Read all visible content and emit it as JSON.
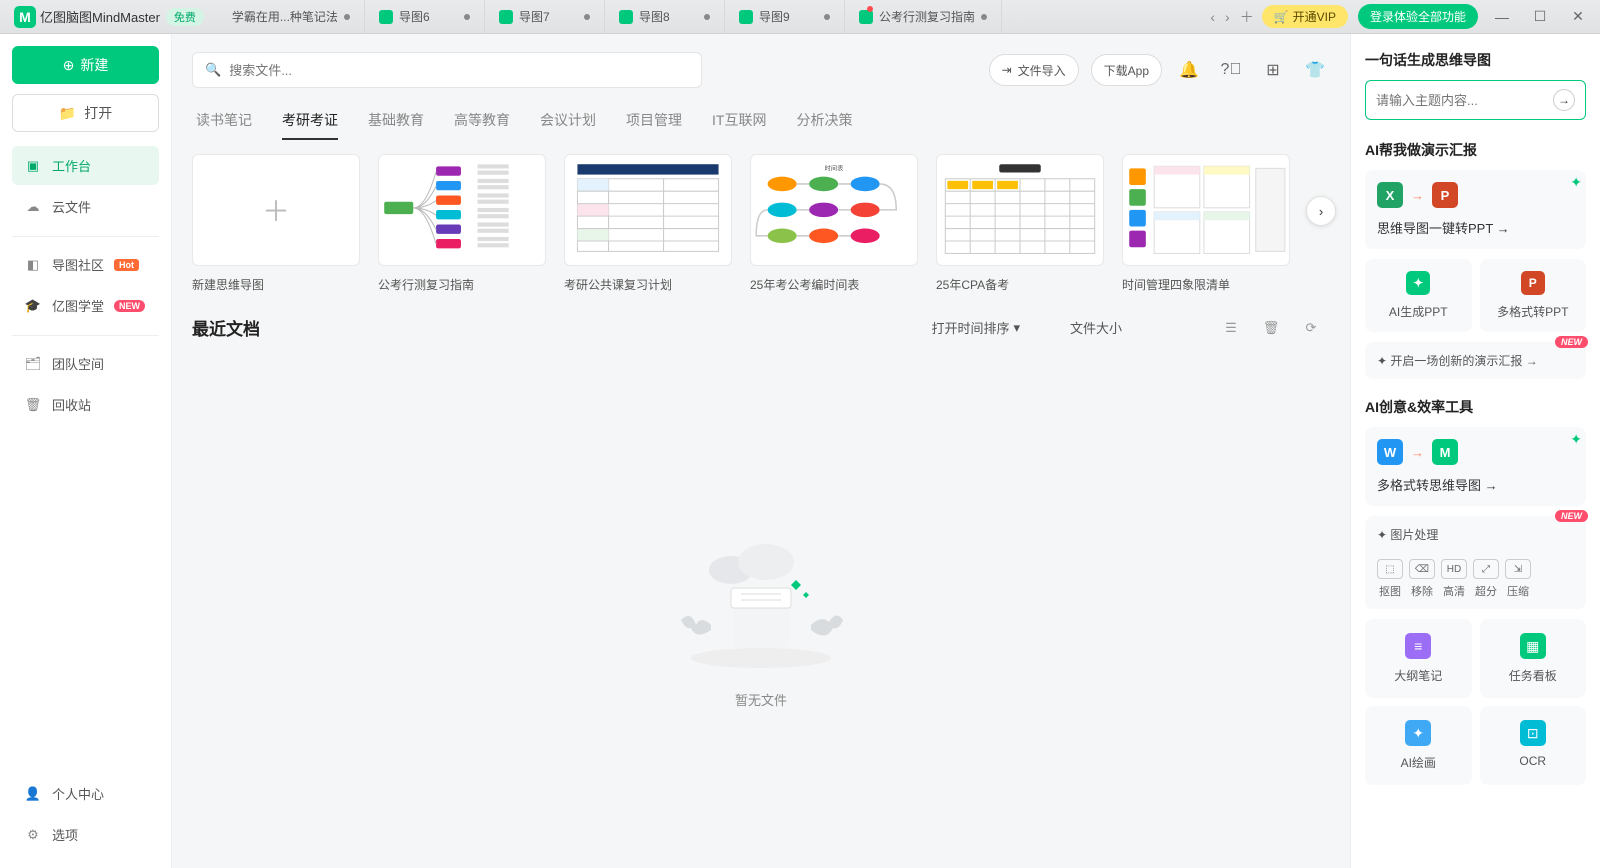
{
  "app": {
    "name": "亿图脑图MindMaster",
    "freeBadge": "免费"
  },
  "tabs": [
    {
      "label": "学霸在用...种笔记法"
    },
    {
      "label": "导图6"
    },
    {
      "label": "导图7"
    },
    {
      "label": "导图8"
    },
    {
      "label": "导图9"
    },
    {
      "label": "公考行测复习指南"
    }
  ],
  "titlebar": {
    "vip": "开通VIP",
    "login": "登录体验全部功能"
  },
  "sidebar": {
    "new": "新建",
    "open": "打开",
    "workspace": "工作台",
    "cloud": "云文件",
    "community": "导图社区",
    "hot": "Hot",
    "school": "亿图学堂",
    "newBadge": "NEW",
    "team": "团队空间",
    "recycle": "回收站",
    "personal": "个人中心",
    "options": "选项"
  },
  "topbar": {
    "searchPlaceholder": "搜索文件...",
    "import": "文件导入",
    "download": "下载App"
  },
  "categories": [
    "读书笔记",
    "考研考证",
    "基础教育",
    "高等教育",
    "会议计划",
    "项目管理",
    "IT互联网",
    "分析决策"
  ],
  "templates": [
    {
      "label": "新建思维导图"
    },
    {
      "label": "公考行测复习指南"
    },
    {
      "label": "考研公共课复习计划"
    },
    {
      "label": "25年考公考编时间表"
    },
    {
      "label": "25年CPA备考"
    },
    {
      "label": "时间管理四象限清单"
    }
  ],
  "recent": {
    "title": "最近文档",
    "sortTime": "打开时间排序",
    "fileSize": "文件大小",
    "empty": "暂无文件"
  },
  "right": {
    "aiTitle": "一句话生成思维导图",
    "aiPlaceholder": "请输入主题内容...",
    "presentTitle": "AI帮我做演示汇报",
    "toPPT": "思维导图一键转PPT →",
    "aiGenPPT": "AI生成PPT",
    "multiPPT": "多格式转PPT",
    "newPresent": "✦ 开启一场创新的演示汇报 →",
    "creativeTitle": "AI创意&效率工具",
    "toMindmap": "多格式转思维导图 →",
    "imgProcess": "✦ 图片处理",
    "imgTools": [
      "抠图",
      "移除",
      "高清",
      "超分",
      "压缩"
    ],
    "grid": [
      "大纲笔记",
      "任务看板",
      "AI绘画",
      "OCR"
    ]
  }
}
